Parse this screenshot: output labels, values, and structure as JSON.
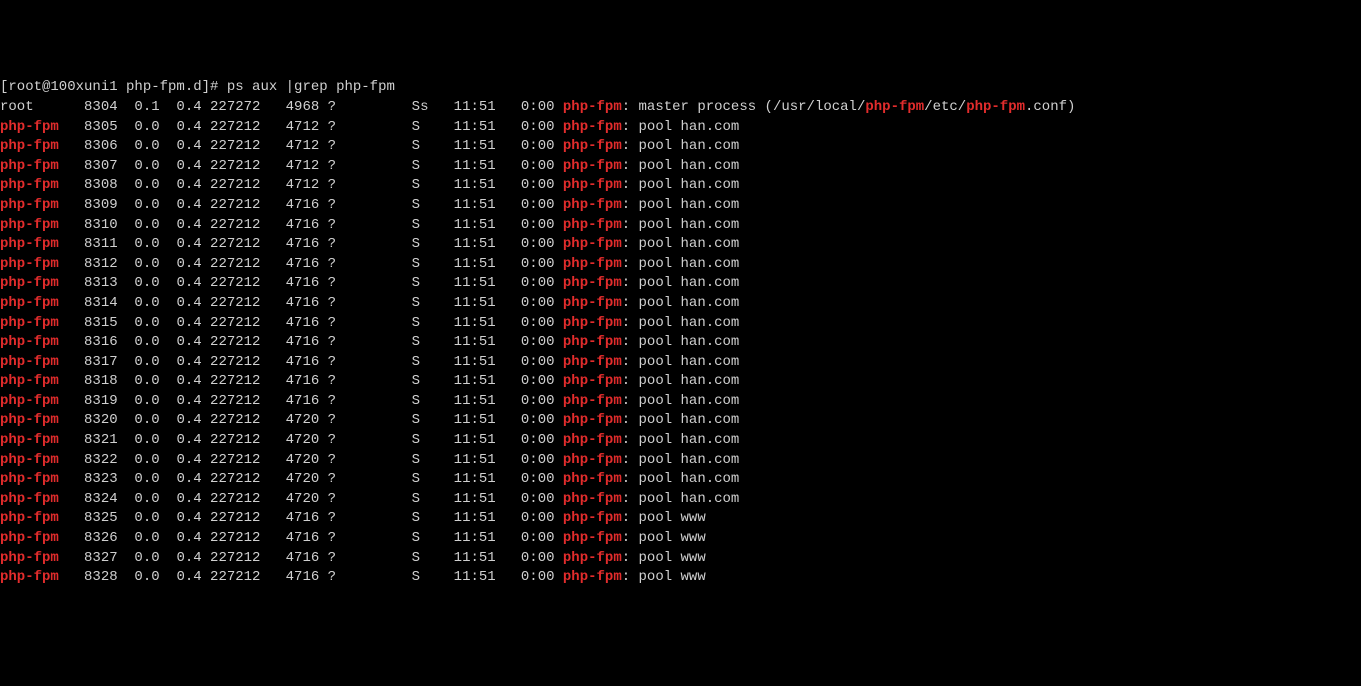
{
  "prompt": {
    "text": "[root@100xuni1 php-fpm.d]# ",
    "command": "ps aux |grep php-fpm"
  },
  "highlight": "php-fpm",
  "root_line": {
    "user": "root",
    "pid": " 8304",
    "cpu": "0.1",
    "mem": "0.4",
    "vsz": "227272",
    "rss": " 4968",
    "tty": "?",
    "stat": "Ss",
    "start": "11:51",
    "time": "0:00",
    "cmd_pre": ": master process (/usr/local/",
    "cmd_mid": "/etc/",
    "cmd_end": ".conf)"
  },
  "rows": [
    {
      "pid": " 8305",
      "cpu": "0.0",
      "mem": "0.4",
      "vsz": "227212",
      "rss": " 4712",
      "tty": "?",
      "stat": "S ",
      "start": "11:51",
      "time": "0:00",
      "pool": "pool han.com"
    },
    {
      "pid": " 8306",
      "cpu": "0.0",
      "mem": "0.4",
      "vsz": "227212",
      "rss": " 4712",
      "tty": "?",
      "stat": "S ",
      "start": "11:51",
      "time": "0:00",
      "pool": "pool han.com"
    },
    {
      "pid": " 8307",
      "cpu": "0.0",
      "mem": "0.4",
      "vsz": "227212",
      "rss": " 4712",
      "tty": "?",
      "stat": "S ",
      "start": "11:51",
      "time": "0:00",
      "pool": "pool han.com"
    },
    {
      "pid": " 8308",
      "cpu": "0.0",
      "mem": "0.4",
      "vsz": "227212",
      "rss": " 4712",
      "tty": "?",
      "stat": "S ",
      "start": "11:51",
      "time": "0:00",
      "pool": "pool han.com"
    },
    {
      "pid": " 8309",
      "cpu": "0.0",
      "mem": "0.4",
      "vsz": "227212",
      "rss": " 4716",
      "tty": "?",
      "stat": "S ",
      "start": "11:51",
      "time": "0:00",
      "pool": "pool han.com"
    },
    {
      "pid": " 8310",
      "cpu": "0.0",
      "mem": "0.4",
      "vsz": "227212",
      "rss": " 4716",
      "tty": "?",
      "stat": "S ",
      "start": "11:51",
      "time": "0:00",
      "pool": "pool han.com"
    },
    {
      "pid": " 8311",
      "cpu": "0.0",
      "mem": "0.4",
      "vsz": "227212",
      "rss": " 4716",
      "tty": "?",
      "stat": "S ",
      "start": "11:51",
      "time": "0:00",
      "pool": "pool han.com"
    },
    {
      "pid": " 8312",
      "cpu": "0.0",
      "mem": "0.4",
      "vsz": "227212",
      "rss": " 4716",
      "tty": "?",
      "stat": "S ",
      "start": "11:51",
      "time": "0:00",
      "pool": "pool han.com"
    },
    {
      "pid": " 8313",
      "cpu": "0.0",
      "mem": "0.4",
      "vsz": "227212",
      "rss": " 4716",
      "tty": "?",
      "stat": "S ",
      "start": "11:51",
      "time": "0:00",
      "pool": "pool han.com"
    },
    {
      "pid": " 8314",
      "cpu": "0.0",
      "mem": "0.4",
      "vsz": "227212",
      "rss": " 4716",
      "tty": "?",
      "stat": "S ",
      "start": "11:51",
      "time": "0:00",
      "pool": "pool han.com"
    },
    {
      "pid": " 8315",
      "cpu": "0.0",
      "mem": "0.4",
      "vsz": "227212",
      "rss": " 4716",
      "tty": "?",
      "stat": "S ",
      "start": "11:51",
      "time": "0:00",
      "pool": "pool han.com"
    },
    {
      "pid": " 8316",
      "cpu": "0.0",
      "mem": "0.4",
      "vsz": "227212",
      "rss": " 4716",
      "tty": "?",
      "stat": "S ",
      "start": "11:51",
      "time": "0:00",
      "pool": "pool han.com"
    },
    {
      "pid": " 8317",
      "cpu": "0.0",
      "mem": "0.4",
      "vsz": "227212",
      "rss": " 4716",
      "tty": "?",
      "stat": "S ",
      "start": "11:51",
      "time": "0:00",
      "pool": "pool han.com"
    },
    {
      "pid": " 8318",
      "cpu": "0.0",
      "mem": "0.4",
      "vsz": "227212",
      "rss": " 4716",
      "tty": "?",
      "stat": "S ",
      "start": "11:51",
      "time": "0:00",
      "pool": "pool han.com"
    },
    {
      "pid": " 8319",
      "cpu": "0.0",
      "mem": "0.4",
      "vsz": "227212",
      "rss": " 4716",
      "tty": "?",
      "stat": "S ",
      "start": "11:51",
      "time": "0:00",
      "pool": "pool han.com"
    },
    {
      "pid": " 8320",
      "cpu": "0.0",
      "mem": "0.4",
      "vsz": "227212",
      "rss": " 4720",
      "tty": "?",
      "stat": "S ",
      "start": "11:51",
      "time": "0:00",
      "pool": "pool han.com"
    },
    {
      "pid": " 8321",
      "cpu": "0.0",
      "mem": "0.4",
      "vsz": "227212",
      "rss": " 4720",
      "tty": "?",
      "stat": "S ",
      "start": "11:51",
      "time": "0:00",
      "pool": "pool han.com"
    },
    {
      "pid": " 8322",
      "cpu": "0.0",
      "mem": "0.4",
      "vsz": "227212",
      "rss": " 4720",
      "tty": "?",
      "stat": "S ",
      "start": "11:51",
      "time": "0:00",
      "pool": "pool han.com"
    },
    {
      "pid": " 8323",
      "cpu": "0.0",
      "mem": "0.4",
      "vsz": "227212",
      "rss": " 4720",
      "tty": "?",
      "stat": "S ",
      "start": "11:51",
      "time": "0:00",
      "pool": "pool han.com"
    },
    {
      "pid": " 8324",
      "cpu": "0.0",
      "mem": "0.4",
      "vsz": "227212",
      "rss": " 4720",
      "tty": "?",
      "stat": "S ",
      "start": "11:51",
      "time": "0:00",
      "pool": "pool han.com"
    },
    {
      "pid": " 8325",
      "cpu": "0.0",
      "mem": "0.4",
      "vsz": "227212",
      "rss": " 4716",
      "tty": "?",
      "stat": "S ",
      "start": "11:51",
      "time": "0:00",
      "pool": "pool www"
    },
    {
      "pid": " 8326",
      "cpu": "0.0",
      "mem": "0.4",
      "vsz": "227212",
      "rss": " 4716",
      "tty": "?",
      "stat": "S ",
      "start": "11:51",
      "time": "0:00",
      "pool": "pool www"
    },
    {
      "pid": " 8327",
      "cpu": "0.0",
      "mem": "0.4",
      "vsz": "227212",
      "rss": " 4716",
      "tty": "?",
      "stat": "S ",
      "start": "11:51",
      "time": "0:00",
      "pool": "pool www"
    },
    {
      "pid": " 8328",
      "cpu": "0.0",
      "mem": "0.4",
      "vsz": "227212",
      "rss": " 4716",
      "tty": "?",
      "stat": "S ",
      "start": "11:51",
      "time": "0:00",
      "pool": "pool www"
    }
  ]
}
